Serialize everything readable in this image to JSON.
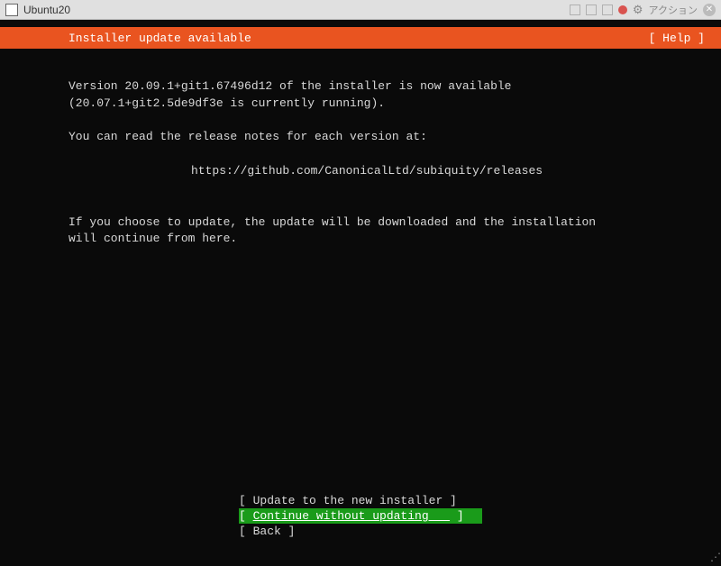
{
  "titlebar": {
    "title": "Ubuntu20",
    "action_label": "アクション"
  },
  "header": {
    "title": "Installer update available",
    "help_label": "[ Help ]"
  },
  "body": {
    "line1": "Version 20.09.1+git1.67496d12 of the installer is now available",
    "line2": "(20.07.1+git2.5de9df3e is currently running).",
    "line3": "You can read the release notes for each version at:",
    "url": "https://github.com/CanonicalLtd/subiquity/releases",
    "line4": "If you choose to update, the update will be downloaded and the installation",
    "line5": "will continue from here."
  },
  "buttons": {
    "update": "Update to the new installer",
    "continue": "Continue without updating   ",
    "back": "Back"
  },
  "colors": {
    "accent": "#e95420",
    "selected": "#1a9b1a",
    "bg": "#0a0a0a"
  }
}
